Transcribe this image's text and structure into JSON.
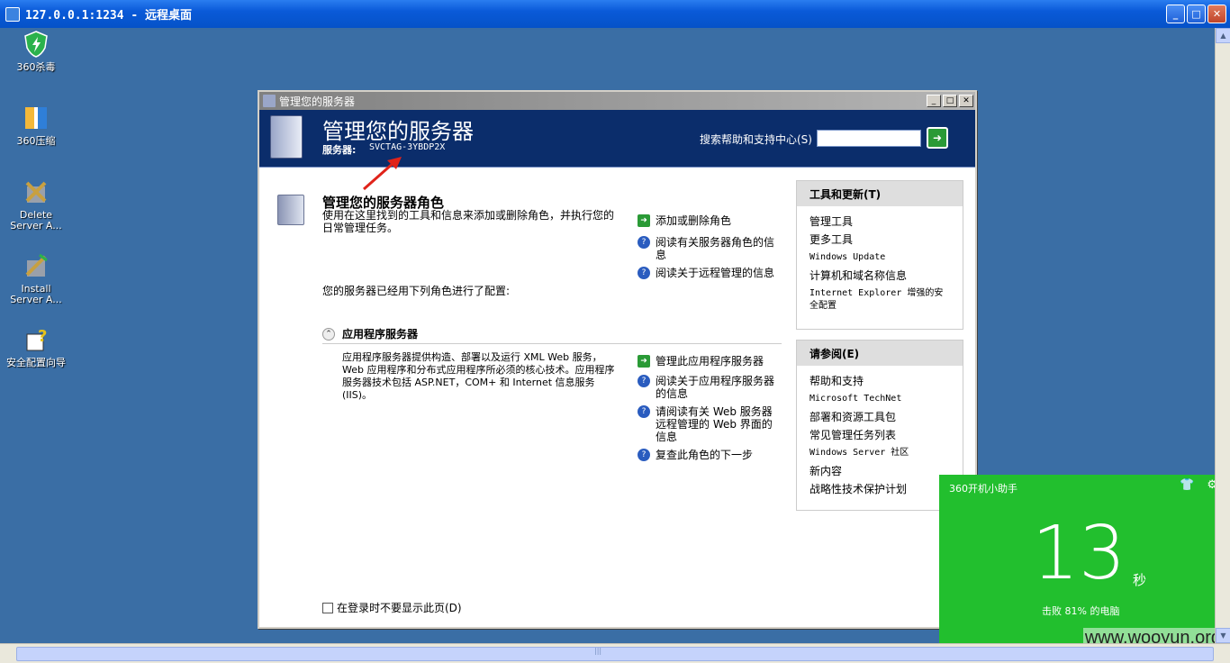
{
  "outer": {
    "title": "127.0.0.1:1234 - 远程桌面"
  },
  "desktop": {
    "icons": [
      {
        "label": "360杀毒"
      },
      {
        "label": "360压缩"
      },
      {
        "label": "Delete Server A..."
      },
      {
        "label": "Install Server A..."
      },
      {
        "label": "安全配置向导"
      }
    ]
  },
  "manager": {
    "window_title": "管理您的服务器",
    "banner_title": "管理您的服务器",
    "server_label": "服务器:",
    "server_name": "SVCTAG-3YBDP2X",
    "search_label": "搜索帮助和支持中心(S)",
    "search_value": "",
    "roles_title": "管理您的服务器角色",
    "roles_desc": "使用在这里找到的工具和信息来添加或删除角色，并执行您的日常管理任务。",
    "roles_links": [
      "添加或删除角色",
      "阅读有关服务器角色的信息",
      "阅读关于远程管理的信息"
    ],
    "configured_text": "您的服务器已经用下列角色进行了配置:",
    "app_server_title": "应用程序服务器",
    "app_server_desc": "应用程序服务器提供构造、部署以及运行 XML Web 服务，Web 应用程序和分布式应用程序所必须的核心技术。应用程序服务器技术包括 ASP.NET，COM+ 和 Internet 信息服务(IIS)。",
    "app_links": [
      "管理此应用程序服务器",
      "阅读关于应用程序服务器的信息",
      "请阅读有关 Web 服务器远程管理的 Web 界面的信息",
      "复查此角色的下一步"
    ],
    "checkbox_label": "在登录时不要显示此页(D)",
    "tools": {
      "title": "工具和更新(T)",
      "items": [
        "管理工具",
        "更多工具",
        "Windows Update",
        "计算机和域名称信息",
        "Internet Explorer 增强的安全配置"
      ]
    },
    "see_also": {
      "title": "请参阅(E)",
      "items": [
        "帮助和支持",
        "Microsoft TechNet",
        "部署和资源工具包",
        "常见管理任务列表",
        "Windows Server 社区",
        "新内容",
        "战略性技术保护计划"
      ]
    }
  },
  "popup": {
    "title": "360开机小助手",
    "seconds": "13",
    "unit": "秒",
    "subtitle": "击败 81% 的电脑",
    "watermark": "www.wooyun.org"
  }
}
